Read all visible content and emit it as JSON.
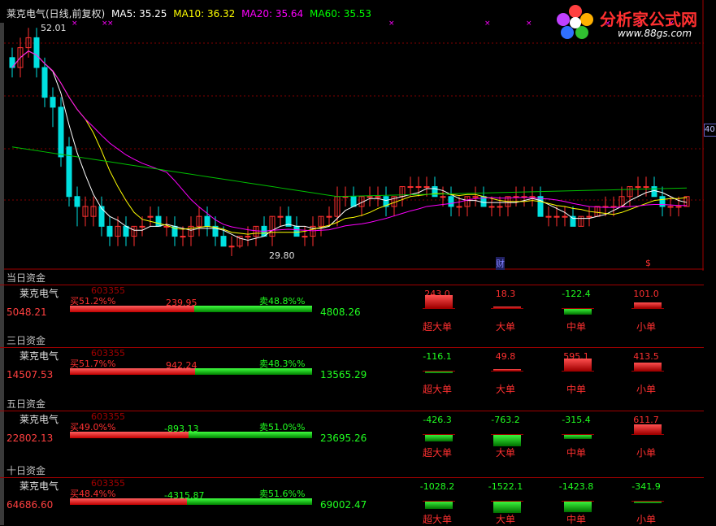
{
  "header": {
    "title": "莱克电气(日线,前复权)",
    "ma5": "MA5: 35.25",
    "ma10": "MA10: 36.32",
    "ma20": "MA20: 35.64",
    "ma60": "MA60: 35.53",
    "colors": {
      "title": "#e0e0e0",
      "ma5": "#ffffff",
      "ma10": "#ffff00",
      "ma20": "#ff00ff",
      "ma60": "#00ff00"
    }
  },
  "logo": {
    "text": "分析家公式网",
    "url": "www.88gs.com"
  },
  "price_chart": {
    "high_label": "52.01",
    "low_label": "29.80",
    "right_axis_value": "40",
    "markers": {
      "cai": "财",
      "dollar": "$"
    }
  },
  "chart_data": {
    "type": "candlestick",
    "title": "莱克电气(日线,前复权)",
    "series_names": [
      "MA5",
      "MA10",
      "MA20",
      "MA60"
    ],
    "y_labels": [
      "52.01",
      "29.80",
      "40"
    ],
    "candles": [
      [
        49,
        50,
        47,
        48
      ],
      [
        48,
        51,
        47,
        50
      ],
      [
        50,
        52,
        49,
        51
      ],
      [
        51,
        52,
        47,
        48
      ],
      [
        48,
        49,
        44,
        45
      ],
      [
        45,
        46,
        42,
        44
      ],
      [
        44,
        45,
        38,
        39
      ],
      [
        40,
        41,
        34,
        35
      ],
      [
        35,
        36,
        32,
        34
      ],
      [
        33,
        35,
        32,
        34
      ],
      [
        33,
        35,
        32,
        34
      ],
      [
        34,
        35,
        31,
        32
      ],
      [
        32,
        33,
        30,
        31
      ],
      [
        31,
        33,
        30,
        32
      ],
      [
        32,
        33,
        30,
        31
      ],
      [
        31,
        32,
        30,
        32
      ],
      [
        32,
        33,
        31,
        32
      ],
      [
        33,
        34,
        32,
        33
      ],
      [
        33,
        34,
        32,
        32
      ],
      [
        32,
        33,
        31,
        32
      ],
      [
        32,
        33,
        30,
        31
      ],
      [
        31,
        32,
        30,
        31
      ],
      [
        31,
        33,
        30,
        32
      ],
      [
        32,
        34,
        31,
        33
      ],
      [
        33,
        34,
        31,
        32
      ],
      [
        32,
        33,
        30,
        31
      ],
      [
        31,
        32,
        30,
        30
      ],
      [
        30,
        31,
        29,
        30
      ],
      [
        30,
        31,
        29.8,
        31
      ],
      [
        31,
        32,
        30,
        31
      ],
      [
        31,
        32,
        30,
        32
      ],
      [
        32,
        33,
        31,
        31
      ],
      [
        31,
        33,
        30,
        33
      ],
      [
        33,
        34,
        32,
        33
      ],
      [
        33,
        34,
        32,
        32
      ],
      [
        32,
        33,
        31,
        31
      ],
      [
        31,
        32,
        30,
        31
      ],
      [
        31,
        33,
        30,
        32
      ],
      [
        32,
        33,
        31,
        33
      ],
      [
        33,
        34,
        32,
        33
      ],
      [
        33,
        36,
        32,
        35
      ],
      [
        35,
        36,
        34,
        35
      ],
      [
        35,
        36,
        34,
        34
      ],
      [
        34,
        35,
        33,
        35
      ],
      [
        35,
        36,
        34,
        35
      ],
      [
        35,
        36,
        34,
        35
      ],
      [
        35,
        36,
        33,
        34
      ],
      [
        34,
        35,
        33,
        35
      ],
      [
        35,
        36,
        34,
        36
      ],
      [
        36,
        37,
        35,
        36
      ],
      [
        36,
        37,
        35,
        36
      ],
      [
        36,
        37,
        35,
        36
      ],
      [
        36,
        37,
        35,
        35
      ],
      [
        35,
        36,
        34,
        35
      ],
      [
        35,
        36,
        33,
        34
      ],
      [
        34,
        35,
        33,
        34
      ],
      [
        34,
        35,
        33,
        35
      ],
      [
        35,
        36,
        34,
        35
      ],
      [
        35,
        36,
        34,
        34
      ],
      [
        34,
        35,
        33,
        34
      ],
      [
        34,
        35,
        33,
        34
      ],
      [
        34,
        35,
        33,
        35
      ],
      [
        35,
        36,
        34,
        35
      ],
      [
        35,
        36,
        34,
        35
      ],
      [
        35,
        36,
        34,
        35
      ],
      [
        35,
        36,
        33,
        33
      ],
      [
        33,
        34,
        32,
        33
      ],
      [
        33,
        34,
        32,
        33
      ],
      [
        33,
        34,
        32,
        33
      ],
      [
        33,
        34,
        32,
        32
      ],
      [
        32,
        33,
        32,
        33
      ],
      [
        33,
        34,
        32,
        33
      ],
      [
        33,
        34,
        33,
        34
      ],
      [
        34,
        35,
        33,
        34
      ],
      [
        34,
        35,
        33,
        34
      ],
      [
        34,
        36,
        34,
        35
      ],
      [
        35,
        36,
        34,
        36
      ],
      [
        36,
        37,
        35,
        36
      ],
      [
        36,
        37,
        35,
        36
      ],
      [
        36,
        37,
        35,
        35
      ],
      [
        35,
        36,
        33,
        34
      ],
      [
        34,
        35,
        33,
        34
      ],
      [
        34,
        35,
        33,
        34
      ],
      [
        34,
        35,
        34,
        35
      ]
    ],
    "ylim": [
      29.0,
      53.0
    ]
  },
  "panels": [
    {
      "title": "当日资金",
      "name": "莱克电气",
      "code": "603355",
      "buy_pct": "买51.2%%",
      "sell_pct": "卖48.8%%",
      "buy_amt": "5048.21",
      "sell_amt": "4808.26",
      "net": "239.95",
      "net_color": "#ff3030",
      "buy_ratio": 0.512,
      "cats": [
        {
          "label": "超大单",
          "value": "243.0",
          "num": 243.0
        },
        {
          "label": "大单",
          "value": "18.3",
          "num": 18.3
        },
        {
          "label": "中单",
          "value": "-122.4",
          "num": -122.4
        },
        {
          "label": "小单",
          "value": "101.0",
          "num": 101.0
        }
      ]
    },
    {
      "title": "三日资金",
      "name": "莱克电气",
      "code": "603355",
      "buy_pct": "买51.7%%",
      "sell_pct": "卖48.3%%",
      "buy_amt": "14507.53",
      "sell_amt": "13565.29",
      "net": "942.24",
      "net_color": "#ff3030",
      "buy_ratio": 0.517,
      "cats": [
        {
          "label": "超大单",
          "value": "-116.1",
          "num": -116.1
        },
        {
          "label": "大单",
          "value": "49.8",
          "num": 49.8
        },
        {
          "label": "中单",
          "value": "595.1",
          "num": 595.1
        },
        {
          "label": "小单",
          "value": "413.5",
          "num": 413.5
        }
      ]
    },
    {
      "title": "五日资金",
      "name": "莱克电气",
      "code": "603355",
      "buy_pct": "买49.0%%",
      "sell_pct": "卖51.0%%",
      "buy_amt": "22802.13",
      "sell_amt": "23695.26",
      "net": "-893.13",
      "net_color": "#20ff20",
      "buy_ratio": 0.49,
      "cats": [
        {
          "label": "超大单",
          "value": "-426.3",
          "num": -426.3
        },
        {
          "label": "大单",
          "value": "-763.2",
          "num": -763.2
        },
        {
          "label": "中单",
          "value": "-315.4",
          "num": -315.4
        },
        {
          "label": "小单",
          "value": "611.7",
          "num": 611.7
        }
      ]
    },
    {
      "title": "十日资金",
      "name": "莱克电气",
      "code": "603355",
      "buy_pct": "买48.4%%",
      "sell_pct": "卖51.6%%",
      "buy_amt": "64686.60",
      "sell_amt": "69002.47",
      "net": "-4315.87",
      "net_color": "#20ff20",
      "buy_ratio": 0.484,
      "cats": [
        {
          "label": "超大单",
          "value": "-1028.2",
          "num": -1028.2
        },
        {
          "label": "大单",
          "value": "-1522.1",
          "num": -1522.1
        },
        {
          "label": "中单",
          "value": "-1423.8",
          "num": -1423.8
        },
        {
          "label": "小单",
          "value": "-341.9",
          "num": -341.9
        }
      ]
    }
  ]
}
